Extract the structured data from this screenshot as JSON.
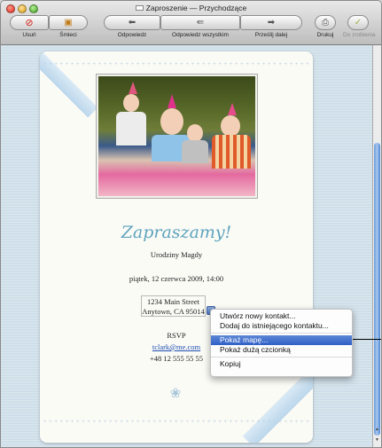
{
  "window": {
    "title": "Zaproszenie — Przychodzące"
  },
  "toolbar": {
    "delete": "Usuń",
    "junk": "Śmieci",
    "reply": "Odpowiedz",
    "reply_all": "Odpowiedz wszystkim",
    "forward": "Prześlij dalej",
    "print": "Drukuj",
    "todo": "Do zrobienia"
  },
  "message": {
    "heading": "Zapraszamy!",
    "occasion": "Urodziny Magdy",
    "datetime": "piątek, 12 czerwca 2009, 14:00",
    "address_line1": "1234 Main Street",
    "address_line2": "Anytown, CA 95014",
    "rsvp": "RSVP",
    "email": "tclark@me.com",
    "phone": "+48 12 555 55 55"
  },
  "context_menu": {
    "items": [
      "Utwórz nowy kontakt...",
      "Dodaj do istniejącego kontaktu...",
      "Pokaż mapę...",
      "Pokaż dużą czcionką",
      "Kopiuj"
    ],
    "selected": "Pokaż mapę..."
  },
  "colors": {
    "accent": "#5ea3be",
    "selection": "#3b67c9",
    "link": "#1f4fb3"
  }
}
